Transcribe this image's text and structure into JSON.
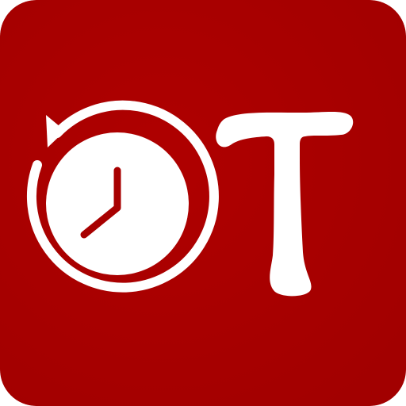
{
  "app_icon": {
    "letter": "T",
    "colors": {
      "background": "#A80000",
      "foreground": "#FFFFFF",
      "clock_hands": "#A80000"
    },
    "icons": {
      "timer": "stopwatch-refresh-icon"
    }
  }
}
